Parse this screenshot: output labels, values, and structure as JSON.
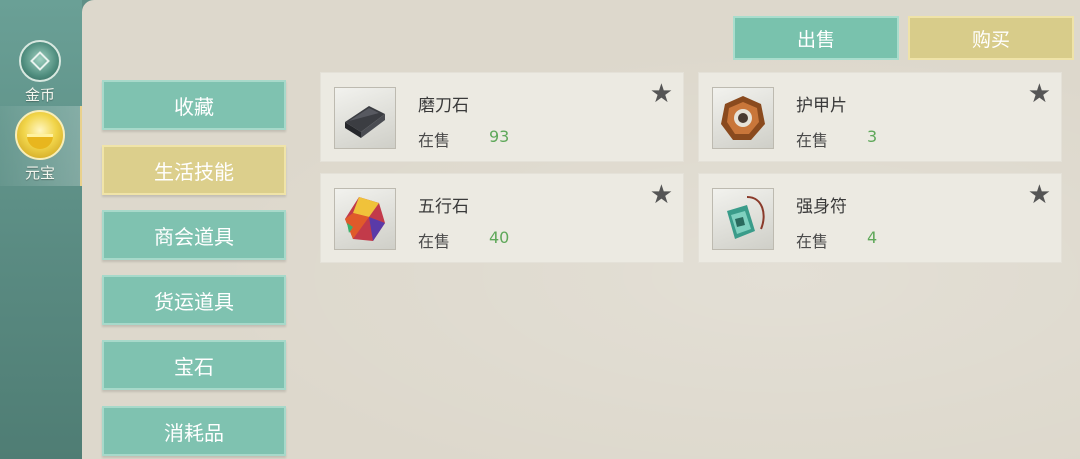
{
  "sidebar": {
    "tabs": [
      {
        "label": "金币",
        "icon": "coin-icon",
        "active": false
      },
      {
        "label": "元宝",
        "icon": "gold-ingot-icon",
        "active": true
      }
    ]
  },
  "header": {
    "sell_label": "出售",
    "buy_label": "购买"
  },
  "categories": [
    {
      "label": "收藏",
      "active": false
    },
    {
      "label": "生活技能",
      "active": true
    },
    {
      "label": "商会道具",
      "active": false
    },
    {
      "label": "货运道具",
      "active": false
    },
    {
      "label": "宝石",
      "active": false
    },
    {
      "label": "消耗品",
      "active": false
    }
  ],
  "items": [
    {
      "name": "磨刀石",
      "sale_label": "在售",
      "count": "93",
      "icon": "whetstone-icon",
      "star": "★"
    },
    {
      "name": "护甲片",
      "sale_label": "在售",
      "count": "3",
      "icon": "armor-plate-icon",
      "star": "★"
    },
    {
      "name": "五行石",
      "sale_label": "在售",
      "count": "40",
      "icon": "five-element-stone-icon",
      "star": "★"
    },
    {
      "name": "强身符",
      "sale_label": "在售",
      "count": "4",
      "icon": "strength-talisman-icon",
      "star": "★"
    }
  ],
  "colors": {
    "teal_button": "#7fc2b0",
    "gold_button": "#dccf8c",
    "panel_bg": "#ddd8cc",
    "count_green": "#5fa85a"
  }
}
